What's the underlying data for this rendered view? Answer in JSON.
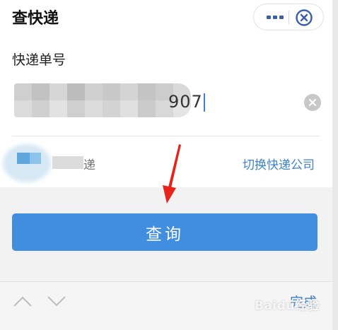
{
  "header": {
    "title": "查快递"
  },
  "colors": {
    "accent": "#418ddf",
    "link": "#3f84c9",
    "annotation_arrow": "#e8231c"
  },
  "form": {
    "tracking_label": "快递单号",
    "tracking_visible_tail": "907",
    "company_visible_suffix": "递",
    "switch_company_label": "切换快递公司"
  },
  "actions": {
    "query_label": "查询"
  },
  "keyboard_bar": {
    "done_label": "完成"
  },
  "watermark": {
    "text": "Baidu经验"
  },
  "icons": {
    "more": "ellipsis-icon",
    "close": "close-circle-icon",
    "clear": "clear-input-icon",
    "up": "chevron-up-icon",
    "down": "chevron-down-icon"
  }
}
